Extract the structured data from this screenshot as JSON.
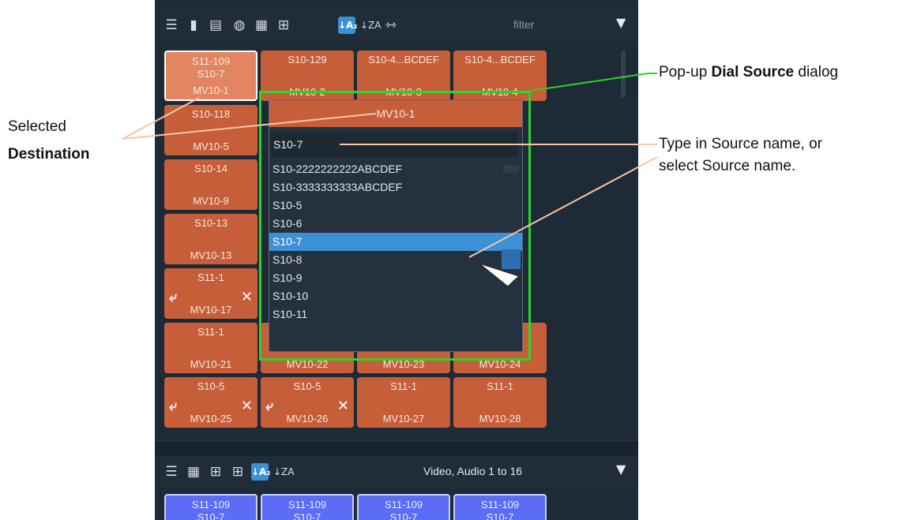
{
  "top_toolbar": {
    "filter_placeholder": "filter",
    "icons": [
      "list-view-icon",
      "document-icon",
      "clipboard-icon",
      "info-icon",
      "large-grid-icon",
      "small-grid-icon",
      "sort-a-z-icon",
      "sort-z-a-icon",
      "fit-width-icon",
      "filter-funnel-icon"
    ],
    "sort_az": "↓A₂",
    "sort_za": "↓ZA"
  },
  "tiles": [
    {
      "line1": "S11-109",
      "line2": "S10-7",
      "line3": "MV10-1",
      "selected": true
    },
    {
      "line1": "S10-129",
      "line2": "",
      "line3": "MV10-2"
    },
    {
      "line1": "S10-4...BCDEF",
      "line2": "",
      "line3": "MV10-3"
    },
    {
      "line1": "S10-4...BCDEF",
      "line2": "",
      "line3": "MV10-4"
    },
    {
      "line1": "S10-118",
      "line2": "",
      "line3": "MV10-5"
    },
    {
      "line1": "S10-14",
      "line2": "",
      "line3": "MV10-9"
    },
    {
      "line1": "S10-13",
      "line2": "",
      "line3": "MV10-13"
    },
    {
      "line1": "S11-1",
      "line2": "",
      "line3": "MV10-17",
      "swap": true
    },
    {
      "line1": "S11-1",
      "line2": "",
      "line3": "MV10-21"
    },
    {
      "line1": "",
      "line2": "",
      "line3": "MV10-22"
    },
    {
      "line1": "",
      "line2": "",
      "line3": "MV10-23"
    },
    {
      "line1": "",
      "line2": "",
      "line3": "MV10-24"
    },
    {
      "line1": "S10-5",
      "line2": "",
      "line3": "MV10-25",
      "swap": true
    },
    {
      "line1": "S10-5",
      "line2": "",
      "line3": "MV10-26",
      "swap": true
    },
    {
      "line1": "S11-1",
      "line2": "",
      "line3": "MV10-27"
    },
    {
      "line1": "S11-1",
      "line2": "",
      "line3": "MV10-28"
    }
  ],
  "dialog": {
    "title": "MV10-1",
    "input_value": "S10-7",
    "sources": [
      "S10-2222222222ABCDEF",
      "S10-3333333333ABCDEF",
      "S10-5",
      "S10-6",
      "S10-7",
      "S10-8",
      "S10-9",
      "S10-10",
      "S10-11"
    ],
    "highlighted_index": 4
  },
  "bottom_toolbar": {
    "level_label": "Video, Audio 1 to 16",
    "icons": [
      "list-view-icon",
      "large-grid-icon",
      "small-grid-icon",
      "dual-grid-icon",
      "sort-a-z-icon",
      "sort-z-a-icon",
      "filter-funnel-icon"
    ]
  },
  "bottom_tiles": [
    {
      "line1": "S11-109",
      "line2": "S10-7"
    },
    {
      "line1": "S11-109",
      "line2": "S10-7"
    },
    {
      "line1": "S11-109",
      "line2": "S10-7"
    },
    {
      "line1": "S11-109",
      "line2": "S10-7"
    }
  ],
  "callouts": {
    "dialog_prefix": "Pop-up ",
    "dialog_bold": "Dial Source",
    "dialog_suffix": " dialog",
    "selected_line1": "Selected",
    "selected_bold": "Destination",
    "type_line1": "Type in Source name, or",
    "type_line2": "select Source name."
  },
  "colors": {
    "tile": "#c65e3a",
    "tile_selected": "#e28661",
    "tile_blue": "#5b6cf5",
    "highlight": "#3d8fd6",
    "frame": "#2ad42a",
    "panel": "#1e2a36"
  }
}
